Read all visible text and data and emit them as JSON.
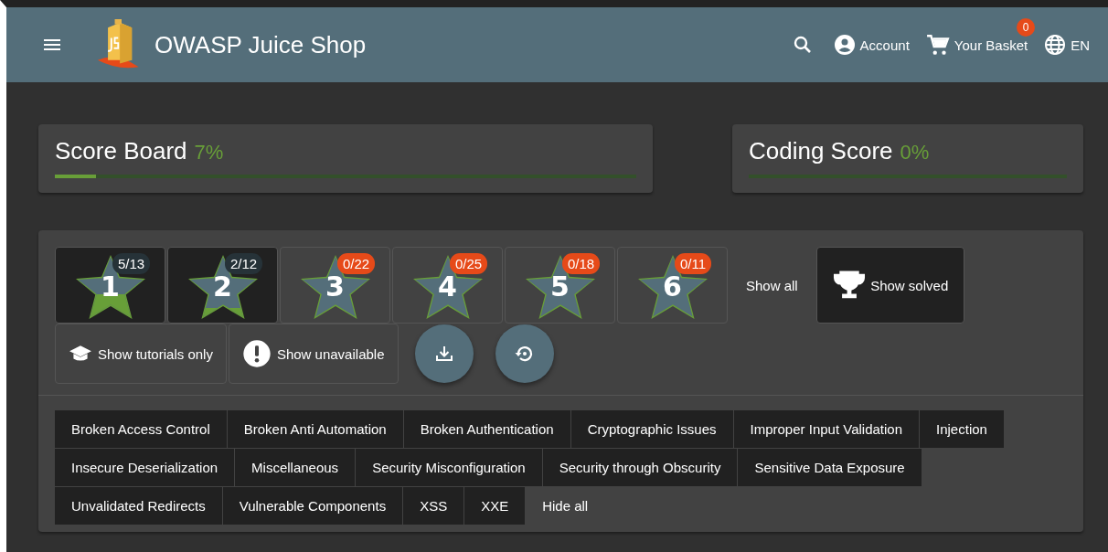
{
  "header": {
    "title": "OWASP Juice Shop",
    "account": "Account",
    "basket": "Your Basket",
    "basket_count": "0",
    "language": "EN"
  },
  "score_cards": [
    {
      "title": "Score Board",
      "percent": "7%"
    },
    {
      "title": "Coding Score",
      "percent": "0%"
    }
  ],
  "difficulties": [
    {
      "label": "1",
      "count": "5/13",
      "selected": true,
      "color": "#263238"
    },
    {
      "label": "2",
      "count": "2/12",
      "selected": true,
      "color": "#263238"
    },
    {
      "label": "3",
      "count": "0/22",
      "selected": false,
      "color": "#e64a19"
    },
    {
      "label": "4",
      "count": "0/25",
      "selected": false,
      "color": "#e64a19"
    },
    {
      "label": "5",
      "count": "0/18",
      "selected": false,
      "color": "#e64a19"
    },
    {
      "label": "6",
      "count": "0/11",
      "selected": false,
      "color": "#e64a19"
    }
  ],
  "status_filters": [
    {
      "label": "Show all",
      "kind": "text",
      "selected": false
    },
    {
      "label": "Show solved",
      "kind": "trophy",
      "selected": true
    }
  ],
  "toggles": [
    {
      "label": "Show tutorials only",
      "kind": "tutorial",
      "selected": false
    },
    {
      "label": "Show unavailable",
      "kind": "unavailable",
      "selected": false
    }
  ],
  "actions": [
    {
      "kind": "download"
    },
    {
      "kind": "restore"
    }
  ],
  "categories": [
    {
      "label": "Broken Access Control",
      "selected": true
    },
    {
      "label": "Broken Anti Automation",
      "selected": true
    },
    {
      "label": "Broken Authentication",
      "selected": true
    },
    {
      "label": "Cryptographic Issues",
      "selected": true
    },
    {
      "label": "Improper Input Validation",
      "selected": true
    },
    {
      "label": "Injection",
      "selected": true
    },
    {
      "label": "Insecure Deserialization",
      "selected": true
    },
    {
      "label": "Miscellaneous",
      "selected": true
    },
    {
      "label": "Security Misconfiguration",
      "selected": true
    },
    {
      "label": "Security through Obscurity",
      "selected": true
    },
    {
      "label": "Sensitive Data Exposure",
      "selected": true
    },
    {
      "label": "Unvalidated Redirects",
      "selected": true
    },
    {
      "label": "Vulnerable Components",
      "selected": true
    },
    {
      "label": "XSS",
      "selected": true
    },
    {
      "label": "XXE",
      "selected": true
    }
  ],
  "hide_all": "Hide all"
}
